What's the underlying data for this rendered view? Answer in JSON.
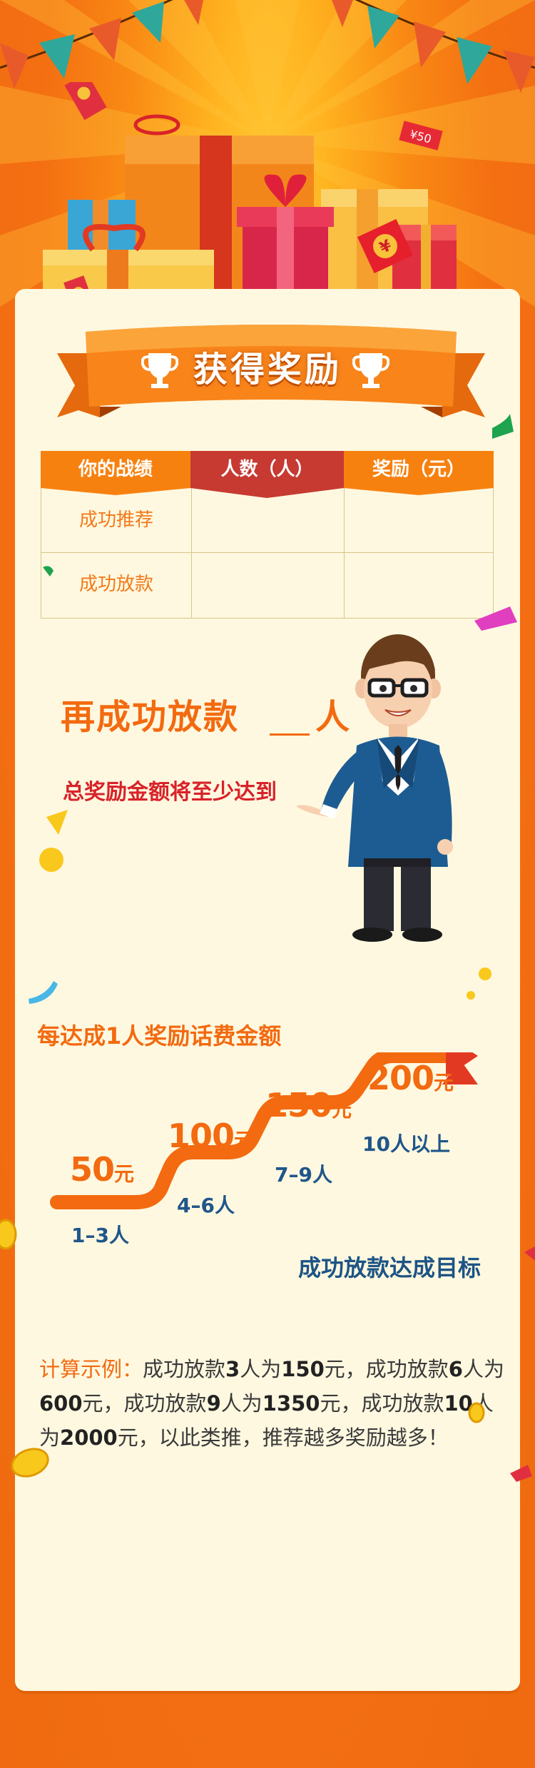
{
  "banner": {
    "title": "获得奖励"
  },
  "gift_tag": "¥50",
  "table": {
    "headers": [
      "你的战绩",
      "人数（人）",
      "奖励（元）"
    ],
    "rows": [
      {
        "label": "成功推荐",
        "count": "",
        "reward": ""
      },
      {
        "label": "成功放款",
        "count": "",
        "reward": ""
      }
    ]
  },
  "middle": {
    "headline": "再成功放款",
    "headline_unit": "人",
    "subline": "总奖励金额将至少达到"
  },
  "steps": {
    "title": "每达成1人奖励话费金额",
    "items": [
      {
        "amount": "50",
        "unit": "元",
        "range": "1–3人"
      },
      {
        "amount": "100",
        "unit": "元",
        "range": "4–6人"
      },
      {
        "amount": "150",
        "unit": "元",
        "range": "7–9人"
      },
      {
        "amount": "200",
        "unit": "元",
        "range": "10人以上"
      }
    ],
    "goal": "成功放款达成目标"
  },
  "example": {
    "lead": "计算示例：",
    "parts": [
      "成功放款",
      "3",
      "人为",
      "150",
      "元，成功放款",
      "6",
      "人为",
      "600",
      "元，成功放款",
      "9",
      "人为",
      "1350",
      "元，成功放款",
      "10",
      "人为",
      "2000",
      "元，以此类推，推荐越多奖励越多！"
    ]
  },
  "colors": {
    "background": "#f46f12",
    "card": "#fff8e0",
    "accent_orange": "#f36a10",
    "header_red": "#c63a32",
    "text_blue": "#1d5485",
    "text_red": "#d8232a"
  },
  "icons": [
    "trophy-icon",
    "gift-box-icon",
    "red-envelope-icon",
    "coin-icon",
    "bunting-flag-icon",
    "businessman-figure"
  ]
}
